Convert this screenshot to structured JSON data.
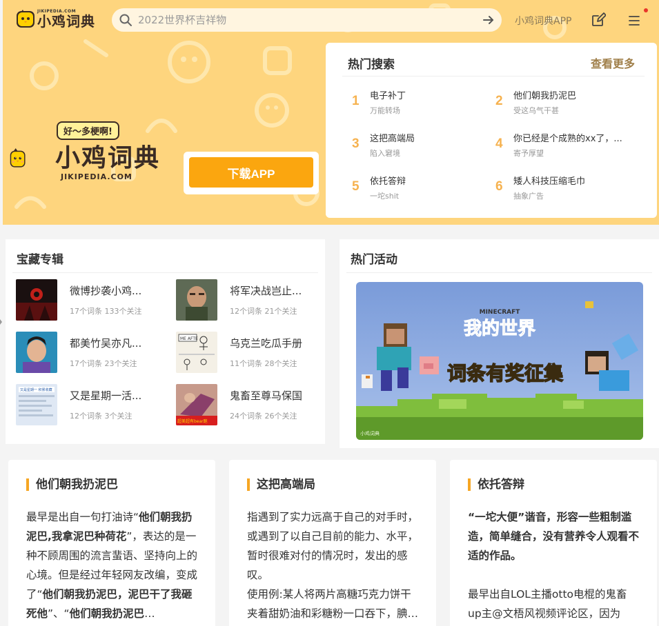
{
  "colors": {
    "hero_bg": "#fed57e",
    "accent": "#f6a623",
    "download_btn": "#fba60f",
    "hot_number": "#f6b24f",
    "more_link": "#a07f4a"
  },
  "header": {
    "logo_domain": "JIKIPEDIA.COM",
    "logo_name": "小鸡词典",
    "search_placeholder": "2022世界杯吉祥物",
    "app_link": "小鸡词典APP",
    "icons": [
      "search-icon",
      "arrow-right-icon",
      "edit-icon",
      "menu-icon"
    ]
  },
  "hero": {
    "bubble": "好～多梗啊!",
    "name": "小鸡词典",
    "domain": "JIKIPEDIA.COM",
    "download": "下载APP"
  },
  "hot_search": {
    "title": "热门搜索",
    "more": "查看更多",
    "items": [
      {
        "num": "1",
        "word": "电子补丁",
        "sub": "万能转场"
      },
      {
        "num": "2",
        "word": "他们朝我扔泥巴",
        "sub": "受这乌气干甚"
      },
      {
        "num": "3",
        "word": "这把高端局",
        "sub": "陷入窘境"
      },
      {
        "num": "4",
        "word": "你已经是个成熟的xx了，...",
        "sub": "寄予厚望"
      },
      {
        "num": "5",
        "word": "依托答辩",
        "sub": "一坨shit"
      },
      {
        "num": "6",
        "word": "矮人科技压缩毛巾",
        "sub": "抽象广告"
      }
    ]
  },
  "treasure": {
    "title": "宝藏专辑",
    "albums": [
      {
        "name": "微博抄袭小鸡...",
        "meta": "17个词条 133个关注"
      },
      {
        "name": "将军决战岂止...",
        "meta": "12个词条 21个关注"
      },
      {
        "name": "都美竹吴亦凡...",
        "meta": "17个词条 23个关注"
      },
      {
        "name": "乌克兰吃瓜手册",
        "meta": "11个词条 28个关注"
      },
      {
        "name": "又是星期一活...",
        "meta": "12个词条 3个关注"
      },
      {
        "name": "鬼畜至尊马保国",
        "meta": "24个词条 26个关注"
      }
    ],
    "thumb_texts": {
      "t4": "ME AFTE",
      "t5": "又是星期一 积累收藏",
      "t6": "超美超有bear跑"
    }
  },
  "activity": {
    "title": "热门活动",
    "banner_brand": "MINECRAFT",
    "banner_game": "我的世界",
    "banner_slogan": "词条有奖征集",
    "banner_tag": "小鸡词典",
    "active_slide": 1,
    "slide_count": 4
  },
  "articles": [
    {
      "title": "他们朝我扔泥巴",
      "p1_a": "最早是出自一句打油诗“",
      "p1_b": "他们朝我扔泥巴,我拿泥巴种荷花",
      "p1_c": "”，表达的是一种不顾周围的流言蜚语、坚持向上的心境。但是经过年轻网友改编，变成了“",
      "p1_d": "他们朝我扔泥巴，泥巴干了我砸死他",
      "p1_e": "”、“",
      "p1_f": "他们朝我扔泥巴",
      "p1_g": "…"
    },
    {
      "title": "这把高端局",
      "p1": "指遇到了实力远高于自己的对手时，或遇到了以自己目前的能力、水平，暂时很难对付的情况时，发出的感叹。",
      "p2": "使用例:某人将两片高糖巧克力饼干夹着甜奶油和彩糖粉一口吞下，腆…"
    },
    {
      "title": "依托答辩",
      "p1": "“一坨大便”谐音，形容一些粗制滥造，简单缝合，没有营养令人观看不适的作品。",
      "p2": "最早出自LOL主播otto电棍的鬼畜up主@文梧风视频评论区，因为他…"
    }
  ]
}
